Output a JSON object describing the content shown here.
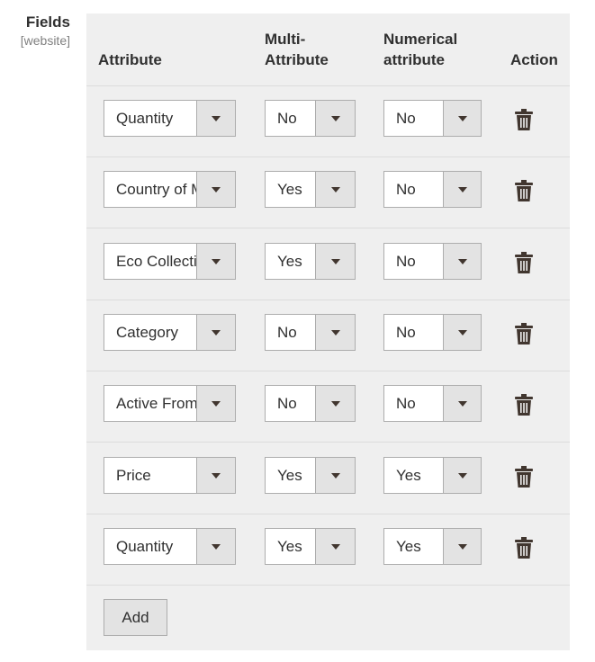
{
  "field": {
    "label": "Fields",
    "scope": "[website]"
  },
  "columns": {
    "attribute": "Attribute",
    "multi_line1": "Multi-",
    "multi_line2": "Attribute",
    "numerical_line1": "Numerical",
    "numerical_line2": "attribute",
    "action": "Action"
  },
  "rows": [
    {
      "attribute": "Quantity",
      "multi": "No",
      "numerical": "No"
    },
    {
      "attribute": "Country of Manufacture",
      "multi": "Yes",
      "numerical": "No"
    },
    {
      "attribute": "Eco Collection",
      "multi": "Yes",
      "numerical": "No"
    },
    {
      "attribute": "Category",
      "multi": "No",
      "numerical": "No"
    },
    {
      "attribute": "Active From",
      "multi": "No",
      "numerical": "No"
    },
    {
      "attribute": "Price",
      "multi": "Yes",
      "numerical": "Yes"
    },
    {
      "attribute": "Quantity",
      "multi": "Yes",
      "numerical": "Yes"
    }
  ],
  "add_label": "Add",
  "icons": {
    "dropdown": "chevron-down-icon",
    "delete": "trash-icon"
  },
  "colors": {
    "panel": "#efefef",
    "icon": "#41362f",
    "select_button": "#e3e3e3",
    "border": "#adadad"
  }
}
